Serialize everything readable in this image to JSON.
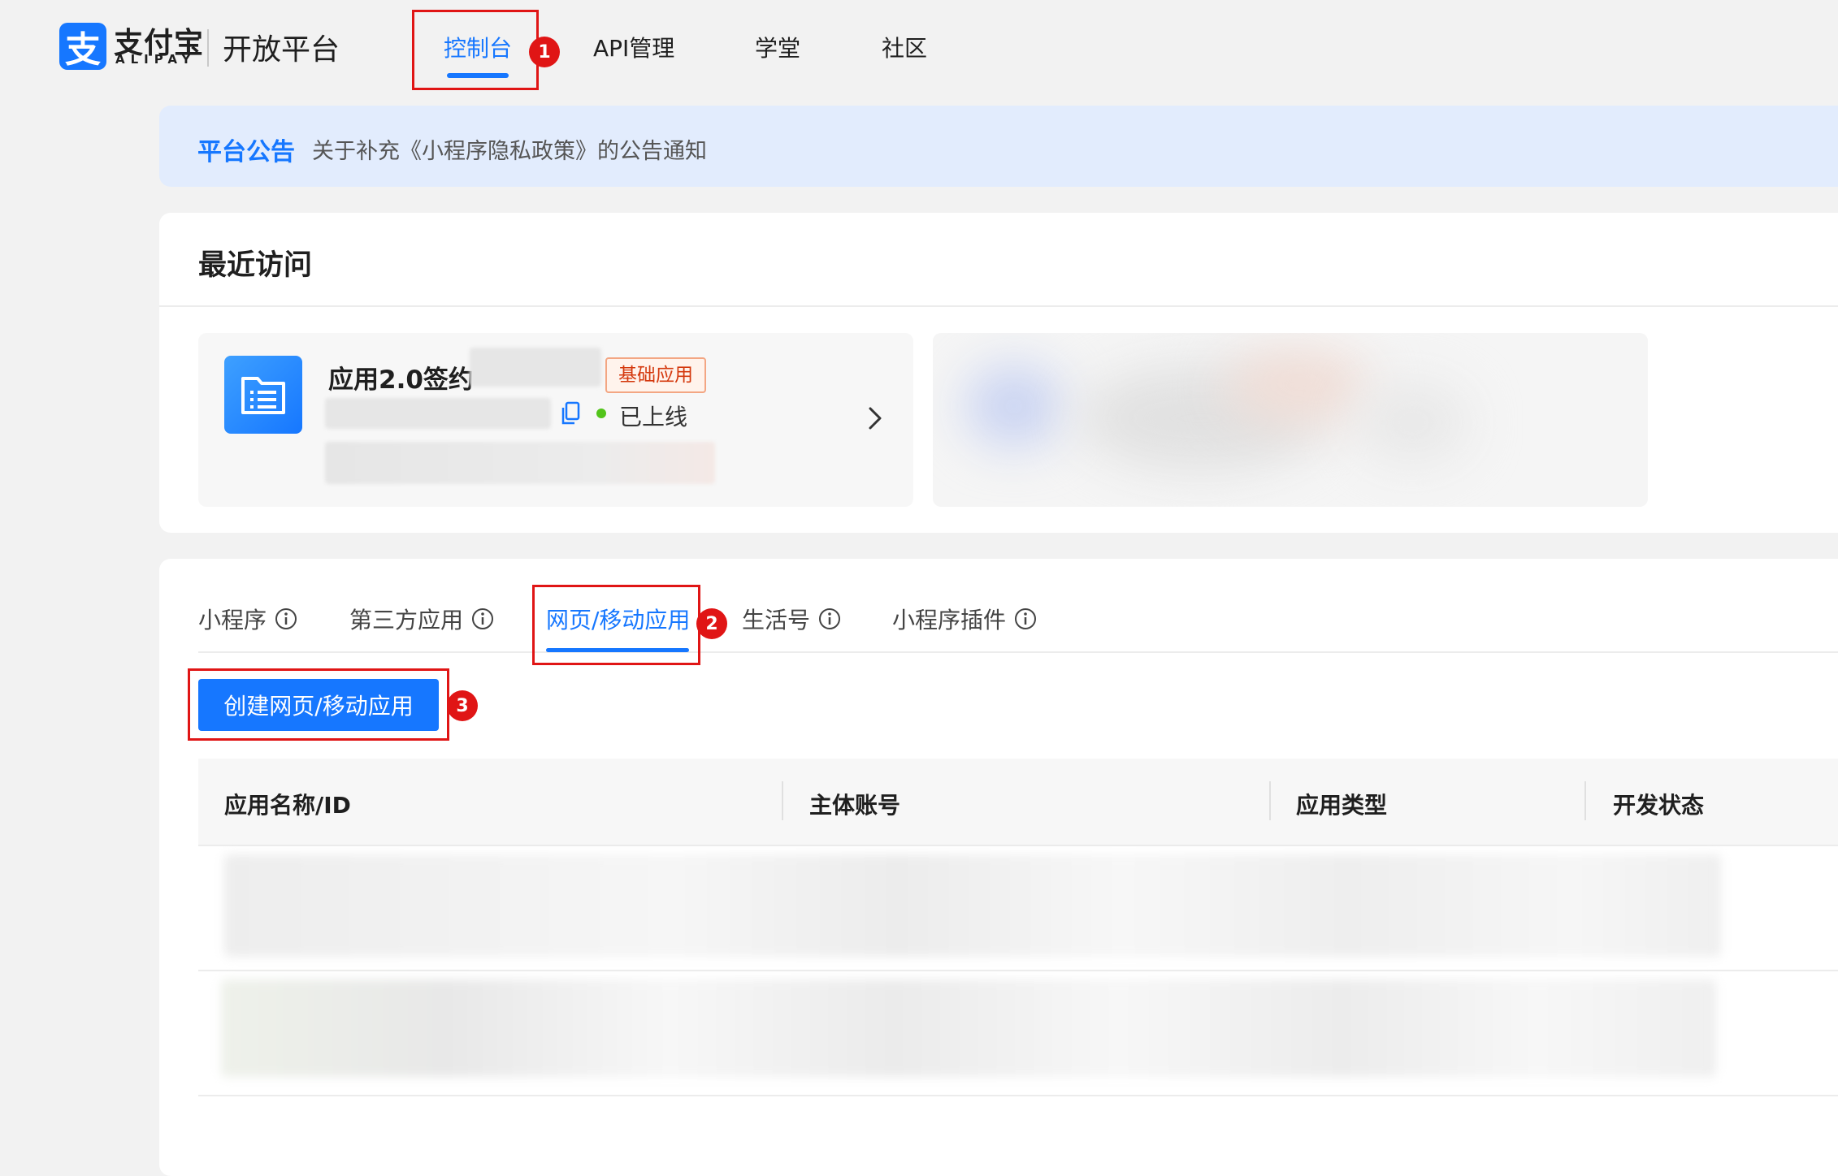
{
  "brand": {
    "mark": "支",
    "name_cn": "支付宝",
    "name_en": "ALIPAY",
    "platform": "开放平台"
  },
  "nav": {
    "items": [
      {
        "label": "控制台"
      },
      {
        "label": "API管理"
      },
      {
        "label": "学堂"
      },
      {
        "label": "社区"
      }
    ]
  },
  "annotations": {
    "m1": "1",
    "m2": "2",
    "m3": "3"
  },
  "notice": {
    "title": "平台公告",
    "text": "关于补充《小程序隐私政策》的公告通知"
  },
  "recent": {
    "title": "最近访问",
    "app": {
      "name": "应用2.0签约",
      "tag": "基础应用",
      "status": "已上线"
    }
  },
  "apps": {
    "tabs": [
      {
        "label": "小程序"
      },
      {
        "label": "第三方应用"
      },
      {
        "label": "网页/移动应用"
      },
      {
        "label": "生活号"
      },
      {
        "label": "小程序插件"
      }
    ],
    "create_button": "创建网页/移动应用",
    "table": {
      "columns": [
        "应用名称/ID",
        "主体账号",
        "应用类型",
        "开发状态"
      ]
    }
  },
  "colors": {
    "accent": "#1677ff",
    "annotation_red": "#e01515",
    "online_green": "#52c41a",
    "tag_orange": "#d4380d"
  }
}
